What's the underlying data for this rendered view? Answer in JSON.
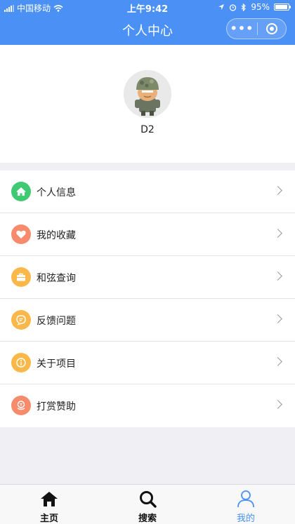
{
  "status_bar": {
    "carrier": "中国移动",
    "time": "上午9:42",
    "battery": "95%"
  },
  "nav": {
    "title": "个人中心",
    "more_label": "•••"
  },
  "profile": {
    "username": "D2"
  },
  "menu": {
    "items": [
      {
        "label": "个人信息",
        "icon": "home-icon",
        "color": "#3ec972"
      },
      {
        "label": "我的收藏",
        "icon": "heart-icon",
        "color": "#f98b6d"
      },
      {
        "label": "和弦查询",
        "icon": "briefcase-icon",
        "color": "#fbb84a"
      },
      {
        "label": "反馈问题",
        "icon": "message-icon",
        "color": "#fbb84a"
      },
      {
        "label": "关于项目",
        "icon": "info-icon",
        "color": "#fbb84a"
      },
      {
        "label": "打赏赞助",
        "icon": "reward-icon",
        "color": "#f98b6d"
      }
    ]
  },
  "tabbar": {
    "tabs": [
      {
        "label": "主页",
        "icon": "home-icon"
      },
      {
        "label": "搜索",
        "icon": "search-icon"
      },
      {
        "label": "我的",
        "icon": "user-icon",
        "active": true
      }
    ]
  },
  "colors": {
    "primary": "#4a90f5",
    "page_bg": "#efeff4"
  }
}
